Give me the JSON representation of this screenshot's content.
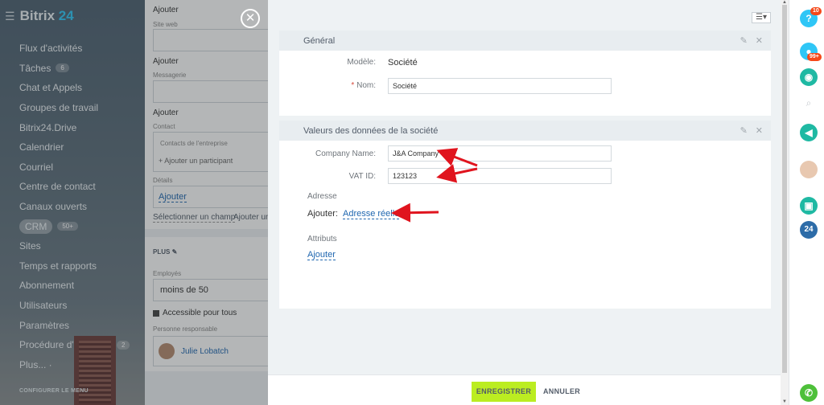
{
  "app": {
    "logo_prefix": "Bitrix",
    "logo_num": "24"
  },
  "sidebar": {
    "items": [
      {
        "label": "Flux d'activités"
      },
      {
        "label": "Tâches",
        "badge": "6"
      },
      {
        "label": "Chat et Appels"
      },
      {
        "label": "Groupes de travail"
      },
      {
        "label": "Bitrix24.Drive"
      },
      {
        "label": "Calendrier"
      },
      {
        "label": "Courriel"
      },
      {
        "label": "Centre de contact"
      },
      {
        "label": "Canaux ouverts"
      },
      {
        "label": "CRM",
        "badge": "50+"
      },
      {
        "label": "Sites"
      },
      {
        "label": "Temps et rapports"
      },
      {
        "label": "Abonnement"
      },
      {
        "label": "Utilisateurs"
      },
      {
        "label": "Paramètres"
      },
      {
        "label": "Procédure d'entrepr...",
        "badge": "2"
      },
      {
        "label": "Plus... ·"
      }
    ],
    "config_label": "CONFIGURER LE MENU"
  },
  "crm": {
    "ajouter": "Ajouter",
    "site_web": "Site web",
    "messagerie": "Messagerie",
    "contact": "Contact",
    "contacts_entreprise": "Contacts de l'entreprise",
    "ajouter_participant": "+ Ajouter un participant",
    "details": "Détails",
    "ajouter_link": "Ajouter",
    "select_field": "Sélectionner un champ",
    "ajouter_un": "Ajouter un",
    "plus": "PLUS",
    "employes": "Employés",
    "employes_value": "moins de 50",
    "accessible": "Accessible pour tous",
    "responsable": "Personne responsable",
    "responsable_name": "Julie Lobatch"
  },
  "panel": {
    "general": {
      "title": "Général",
      "modele_label": "Modèle:",
      "modele_value": "Société",
      "nom_label": "Nom:",
      "nom_required": "*",
      "nom_value": "Société"
    },
    "valeurs": {
      "title": "Valeurs des données de la société",
      "company_label": "Company Name:",
      "company_value": "J&A Company",
      "vat_label": "VAT ID:",
      "vat_value": "123123",
      "adresse_title": "Adresse",
      "ajouter_label": "Ajouter:",
      "adresse_link": "Adresse réelle",
      "attributs_title": "Attributs",
      "attributs_link": "Ajouter"
    },
    "footer": {
      "save": "ENREGISTRER",
      "cancel": "ANNULER"
    }
  },
  "rightbar": {
    "help_badge": "10",
    "notif_badge": "99+",
    "counter_24": "24"
  },
  "colors": {
    "save_bg": "#bbed21",
    "link": "#2067b0",
    "arrow": "#e0141e"
  }
}
